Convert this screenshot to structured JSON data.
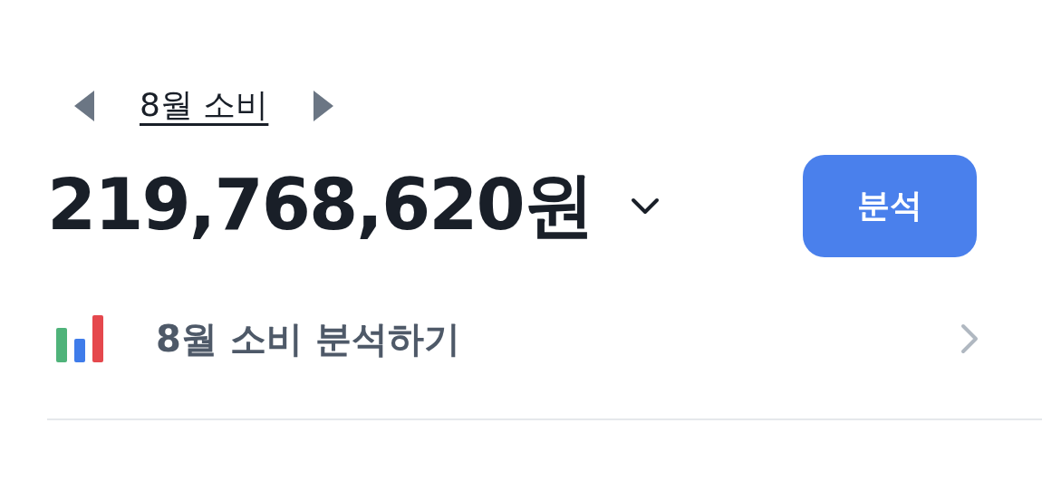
{
  "month_nav": {
    "label": "8월 소비"
  },
  "total": {
    "amount": "219,768,620원"
  },
  "analyze_button": {
    "label": "분석"
  },
  "analysis_row": {
    "label": "8월 소비 분석하기"
  }
}
